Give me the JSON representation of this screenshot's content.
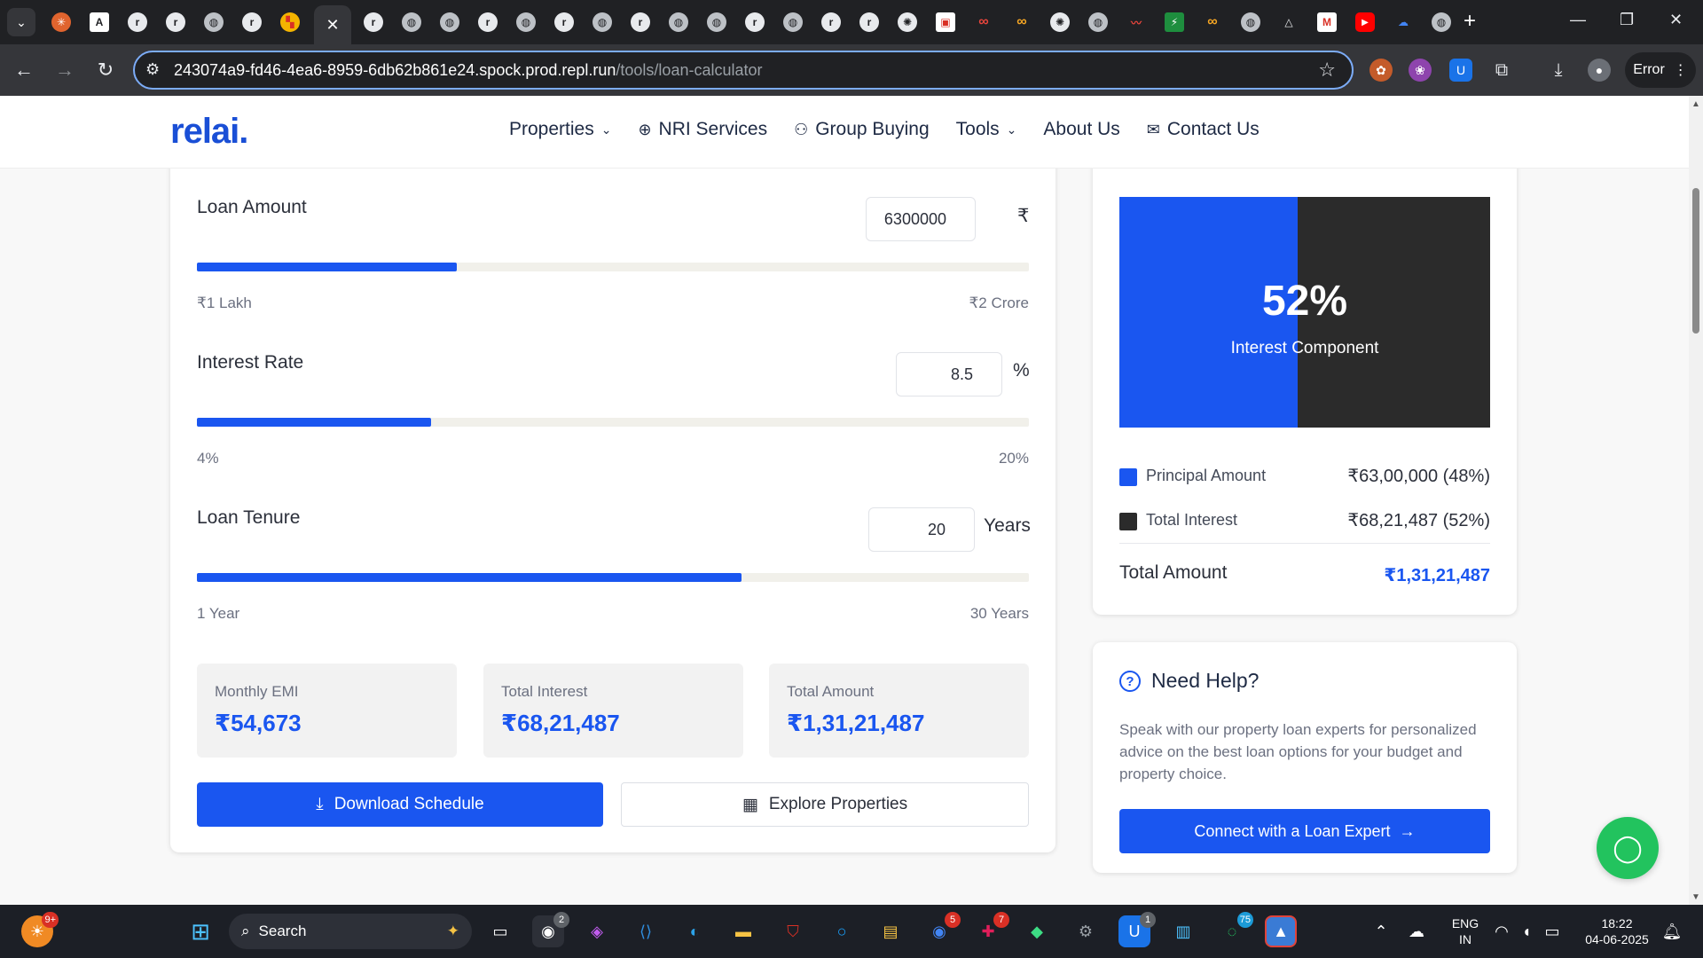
{
  "browser": {
    "active_tab_close": "✕",
    "url_host": "243074a9-fd46-4ea6-8959-6db62b861e24.spock.prod.repl.run",
    "url_path": "/tools/loan-calculator",
    "profile_status": "Error"
  },
  "site": {
    "logo": "relai.",
    "nav": [
      {
        "label": "Properties"
      },
      {
        "label": "NRI Services"
      },
      {
        "label": "Group Buying"
      },
      {
        "label": "Tools"
      },
      {
        "label": "About Us"
      },
      {
        "label": "Contact Us"
      }
    ]
  },
  "calculator": {
    "loan_amount": {
      "label": "Loan Amount",
      "value": "6300000",
      "unit": "₹",
      "min_label": "₹1 Lakh",
      "max_label": "₹2 Crore",
      "fill_fraction": 0.312
    },
    "interest_rate": {
      "label": "Interest Rate",
      "value": "8.5",
      "unit": "%",
      "min_label": "4%",
      "max_label": "20%",
      "fill_fraction": 0.281
    },
    "loan_tenure": {
      "label": "Loan Tenure",
      "value": "20",
      "unit": "Years",
      "min_label": "1 Year",
      "max_label": "30 Years",
      "fill_fraction": 0.655
    },
    "stats": [
      {
        "title": "Monthly EMI",
        "value": "₹54,673"
      },
      {
        "title": "Total Interest",
        "value": "₹68,21,487"
      },
      {
        "title": "Total Amount",
        "value": "₹1,31,21,487"
      }
    ],
    "download_button": "Download Schedule",
    "explore_button": "Explore Properties"
  },
  "breakdown": {
    "percent": "52%",
    "caption": "Interest Component",
    "principal_fraction": 0.48,
    "principal_color": "#1a56f0",
    "interest_color": "#2b2b2b",
    "legend": [
      {
        "name": "Principal Amount",
        "value": "₹63,00,000 (48%)"
      },
      {
        "name": "Total Interest",
        "value": "₹68,21,487 (52%)"
      }
    ],
    "total_label": "Total Amount",
    "total_value": "₹1,31,21,487"
  },
  "help": {
    "title": "Need Help?",
    "text": "Speak with our property loan experts for personalized advice on the best loan options for your budget and property choice.",
    "button": "Connect with a Loan Expert"
  },
  "taskbar": {
    "search_label": "Search",
    "lang_line1": "ENG",
    "lang_line2": "IN",
    "time": "18:22",
    "date": "04-06-2025",
    "badges": {
      "widgets": "9+",
      "chrome1": "2",
      "chrome2": "5",
      "slack": "7",
      "chrome3": "1",
      "whatsapp": "75"
    }
  }
}
